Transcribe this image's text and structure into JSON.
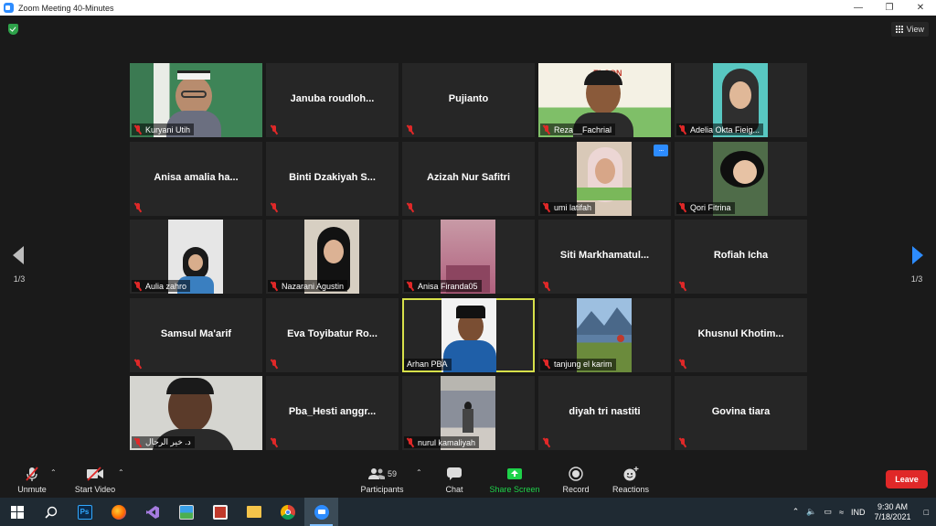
{
  "window": {
    "title": "Zoom Meeting 40-Minutes",
    "controls": [
      "minimize",
      "maximize",
      "close"
    ]
  },
  "header": {
    "security_icon": "shield-check-icon",
    "view_label": "View"
  },
  "pagination": {
    "left_label": "1/3",
    "right_label": "1/3"
  },
  "participants": [
    {
      "name": "Kuryani Utih",
      "video": true,
      "muted": true,
      "scene": "man-glasses-hat-green-wall"
    },
    {
      "name": "Januba  roudloh...",
      "video": false,
      "muted": true
    },
    {
      "name": "Pujianto",
      "video": false,
      "muted": true
    },
    {
      "name": "Reza__Fachrial",
      "video": true,
      "muted": true,
      "scene": "man-banner-background"
    },
    {
      "name": "Adelia Okta Fieig...",
      "video": true,
      "muted": true,
      "scene": "woman-hijab-teal"
    },
    {
      "name": "Anisa amalia ha...",
      "video": false,
      "muted": true
    },
    {
      "name": "Binti  Dzakiyah  S...",
      "video": false,
      "muted": true
    },
    {
      "name": "Azizah Nur Safitri",
      "video": false,
      "muted": true
    },
    {
      "name": "umi latifah",
      "video": true,
      "muted": true,
      "scene": "woman-hijab-green",
      "has_more_button": true
    },
    {
      "name": "Qori Fitrina",
      "video": true,
      "muted": true,
      "scene": "woman-hijab-lying"
    },
    {
      "name": "Aulia zahro",
      "video": true,
      "muted": true,
      "scene": "woman-hijab-blue"
    },
    {
      "name": "Nazarani Agustin",
      "video": true,
      "muted": true,
      "scene": "woman-hijab-black"
    },
    {
      "name": "Anisa Firanda05",
      "video": true,
      "muted": true,
      "scene": "pink-room"
    },
    {
      "name": "Siti Markhamatul...",
      "video": false,
      "muted": true
    },
    {
      "name": "Rofiah Icha",
      "video": false,
      "muted": true
    },
    {
      "name": "Samsul Ma'arif",
      "video": false,
      "muted": true
    },
    {
      "name": "Eva Toyibatur Ro...",
      "video": false,
      "muted": true
    },
    {
      "name": "Arhan PBA",
      "video": true,
      "muted": false,
      "active_speaker": true,
      "scene": "man-peci-blue-jacket"
    },
    {
      "name": "tanjung el karim",
      "video": true,
      "muted": true,
      "scene": "mountain-landscape"
    },
    {
      "name": "Khusnul  Khotim...",
      "video": false,
      "muted": true
    },
    {
      "name": "د. خير الرجال",
      "video": true,
      "muted": true,
      "scene": "man-gray-wall"
    },
    {
      "name": "Pba_Hesti  anggr...",
      "video": false,
      "muted": true
    },
    {
      "name": "nurul kamaliyah",
      "video": true,
      "muted": true,
      "scene": "hallway-person"
    },
    {
      "name": "diyah tri nastiti",
      "video": false,
      "muted": true
    },
    {
      "name": "Govina tiara",
      "video": false,
      "muted": true
    }
  ],
  "toolbar": {
    "unmute": "Unmute",
    "start_video": "Start Video",
    "participants": "Participants",
    "participants_count": "59",
    "chat": "Chat",
    "share_screen": "Share Screen",
    "record": "Record",
    "reactions": "Reactions",
    "leave": "Leave"
  },
  "taskbar": {
    "apps": [
      "start-icon",
      "search-icon",
      "photoshop-icon",
      "firefox-icon",
      "visual-studio-icon",
      "image-viewer-icon",
      "media-icon",
      "file-explorer-icon",
      "chrome-icon",
      "zoom-icon"
    ],
    "language": "IND",
    "time": "9:30 AM",
    "date": "7/18/2021"
  },
  "colors": {
    "accent": "#2d8cff",
    "danger": "#e02828",
    "share": "#1ed24a",
    "active_speaker_border": "#d7e04a",
    "tile_bg": "#262626"
  }
}
